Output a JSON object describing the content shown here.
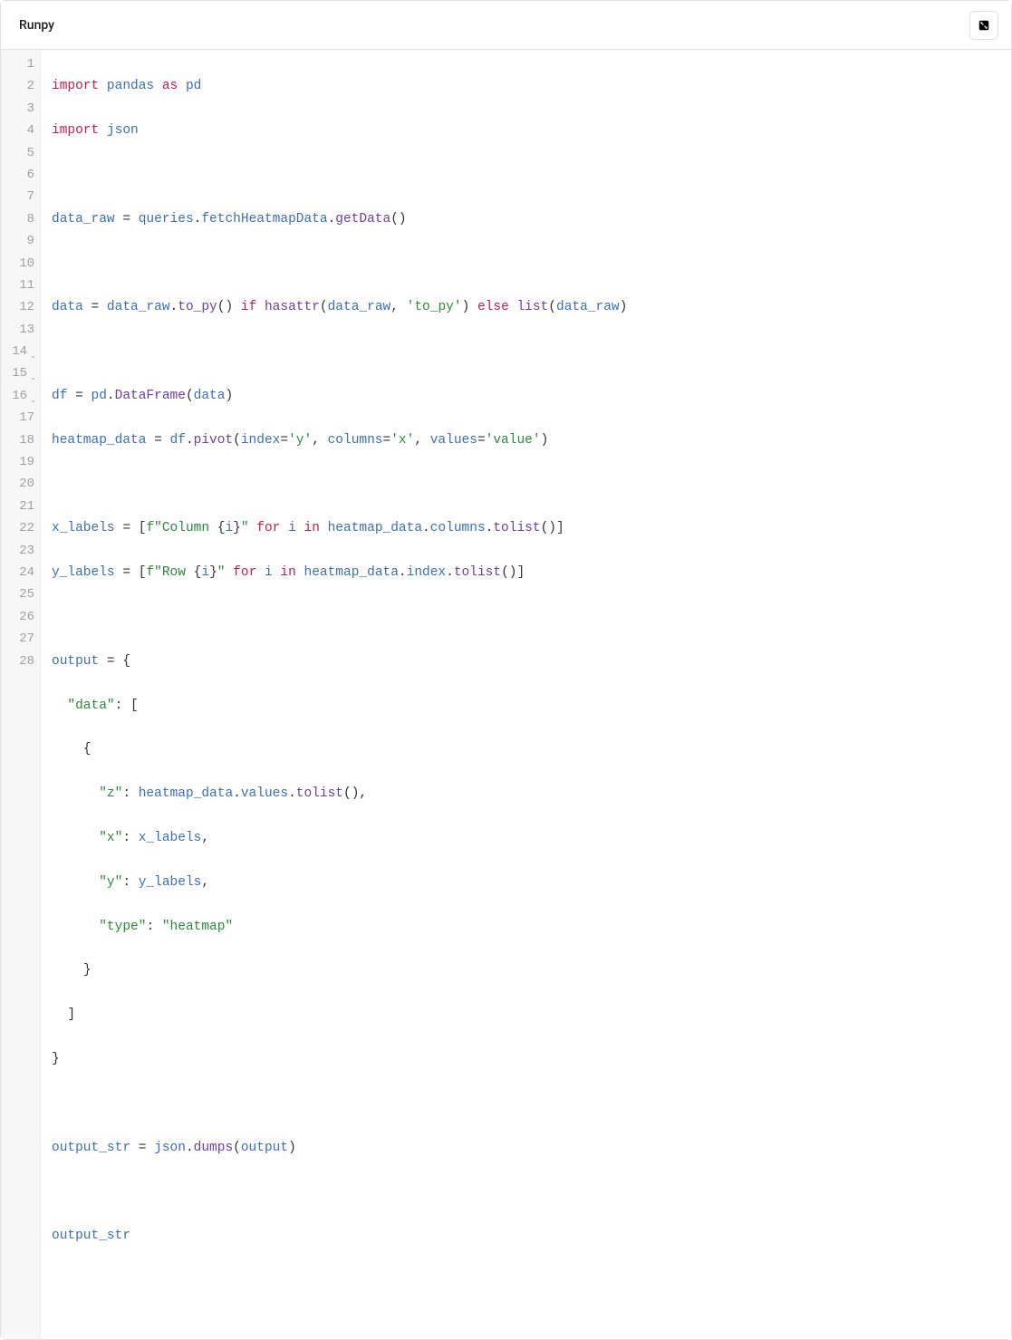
{
  "header": {
    "title": "Runpy",
    "expand_icon": "expand-icon"
  },
  "editor": {
    "line_count": 28,
    "fold_markers": [
      14,
      15,
      16
    ],
    "lines": {
      "l1": {
        "t1": "import",
        "t2": "pandas",
        "t3": "as",
        "t4": "pd"
      },
      "l2": {
        "t1": "import",
        "t2": "json"
      },
      "l4": {
        "t1": "data_raw",
        "t2": "=",
        "t3": "queries",
        "t4": ".",
        "t5": "fetchHeatmapData",
        "t6": ".",
        "t7": "getData",
        "t8": "()"
      },
      "l6": {
        "t1": "data",
        "t2": "=",
        "t3": "data_raw",
        "t4": ".",
        "t5": "to_py",
        "t6": "()",
        "t7": "if",
        "t8": "hasattr",
        "t9": "(",
        "t10": "data_raw",
        "t11": ",",
        "t12": "'to_py'",
        "t13": ")",
        "t14": "else",
        "t15": "list",
        "t16": "(",
        "t17": "data_raw",
        "t18": ")"
      },
      "l8": {
        "t1": "df",
        "t2": "=",
        "t3": "pd",
        "t4": ".",
        "t5": "DataFrame",
        "t6": "(",
        "t7": "data",
        "t8": ")"
      },
      "l9": {
        "t1": "heatmap_data",
        "t2": "=",
        "t3": "df",
        "t4": ".",
        "t5": "pivot",
        "t6": "(",
        "t7": "index",
        "t8": "=",
        "t9": "'y'",
        "t10": ",",
        "t11": "columns",
        "t12": "=",
        "t13": "'x'",
        "t14": ",",
        "t15": "values",
        "t16": "=",
        "t17": "'value'",
        "t18": ")"
      },
      "l11": {
        "t1": "x_labels",
        "t2": "=",
        "t3": "[",
        "t4": "f\"Column ",
        "t5": "{",
        "t6": "i",
        "t7": "}",
        "t8": "\"",
        "t9": "for",
        "t10": "i",
        "t11": "in",
        "t12": "heatmap_data",
        "t13": ".",
        "t14": "columns",
        "t15": ".",
        "t16": "tolist",
        "t17": "()]"
      },
      "l12": {
        "t1": "y_labels",
        "t2": "=",
        "t3": "[",
        "t4": "f\"Row ",
        "t5": "{",
        "t6": "i",
        "t7": "}",
        "t8": "\"",
        "t9": "for",
        "t10": "i",
        "t11": "in",
        "t12": "heatmap_data",
        "t13": ".",
        "t14": "index",
        "t15": ".",
        "t16": "tolist",
        "t17": "()]"
      },
      "l14": {
        "t1": "output",
        "t2": "=",
        "t3": "{"
      },
      "l15": {
        "t1": "  ",
        "t2": "\"data\"",
        "t3": ":",
        "t4": "["
      },
      "l16": {
        "t1": "    ",
        "t2": "{"
      },
      "l17": {
        "t1": "      ",
        "t2": "\"z\"",
        "t3": ":",
        "t4": "heatmap_data",
        "t5": ".",
        "t6": "values",
        "t7": ".",
        "t8": "tolist",
        "t9": "(),"
      },
      "l18": {
        "t1": "      ",
        "t2": "\"x\"",
        "t3": ":",
        "t4": "x_labels",
        "t5": ","
      },
      "l19": {
        "t1": "      ",
        "t2": "\"y\"",
        "t3": ":",
        "t4": "y_labels",
        "t5": ","
      },
      "l20": {
        "t1": "      ",
        "t2": "\"type\"",
        "t3": ":",
        "t4": "\"heatmap\""
      },
      "l21": {
        "t1": "    ",
        "t2": "}"
      },
      "l22": {
        "t1": "  ",
        "t2": "]"
      },
      "l23": {
        "t1": "}"
      },
      "l25": {
        "t1": "output_str",
        "t2": "=",
        "t3": "json",
        "t4": ".",
        "t5": "dumps",
        "t6": "(",
        "t7": "output",
        "t8": ")"
      },
      "l27": {
        "t1": "output_str"
      }
    }
  }
}
